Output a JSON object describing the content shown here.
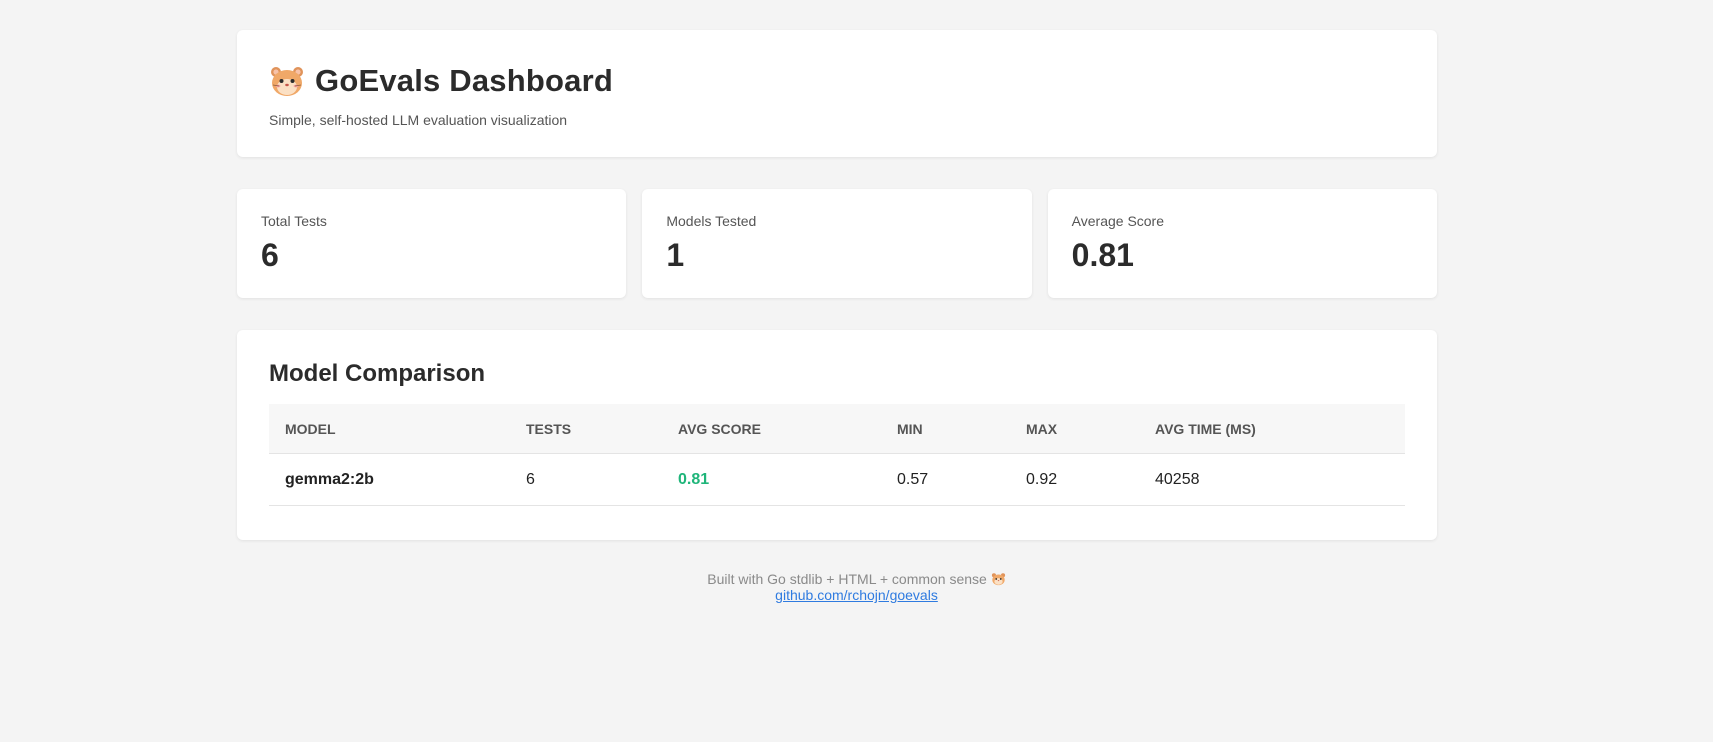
{
  "header": {
    "title": "GoEvals Dashboard",
    "subtitle": "Simple, self-hosted LLM evaluation visualization",
    "logo_icon": "hamster-icon"
  },
  "stats": [
    {
      "label": "Total Tests",
      "value": "6"
    },
    {
      "label": "Models Tested",
      "value": "1"
    },
    {
      "label": "Average Score",
      "value": "0.81"
    }
  ],
  "comparison": {
    "title": "Model Comparison",
    "columns": [
      "Model",
      "Tests",
      "Avg Score",
      "Min",
      "Max",
      "Avg Time (ms)"
    ],
    "rows": [
      {
        "model": "gemma2:2b",
        "tests": "6",
        "avg_score": "0.81",
        "min": "0.57",
        "max": "0.92",
        "avg_time": "40258"
      }
    ],
    "score_color": "#1fb57a"
  },
  "footer": {
    "text": "Built with Go stdlib + HTML + common sense",
    "icon": "hamster-icon",
    "link_text": "github.com/rchojn/goevals",
    "link_color": "#2f7be0"
  }
}
